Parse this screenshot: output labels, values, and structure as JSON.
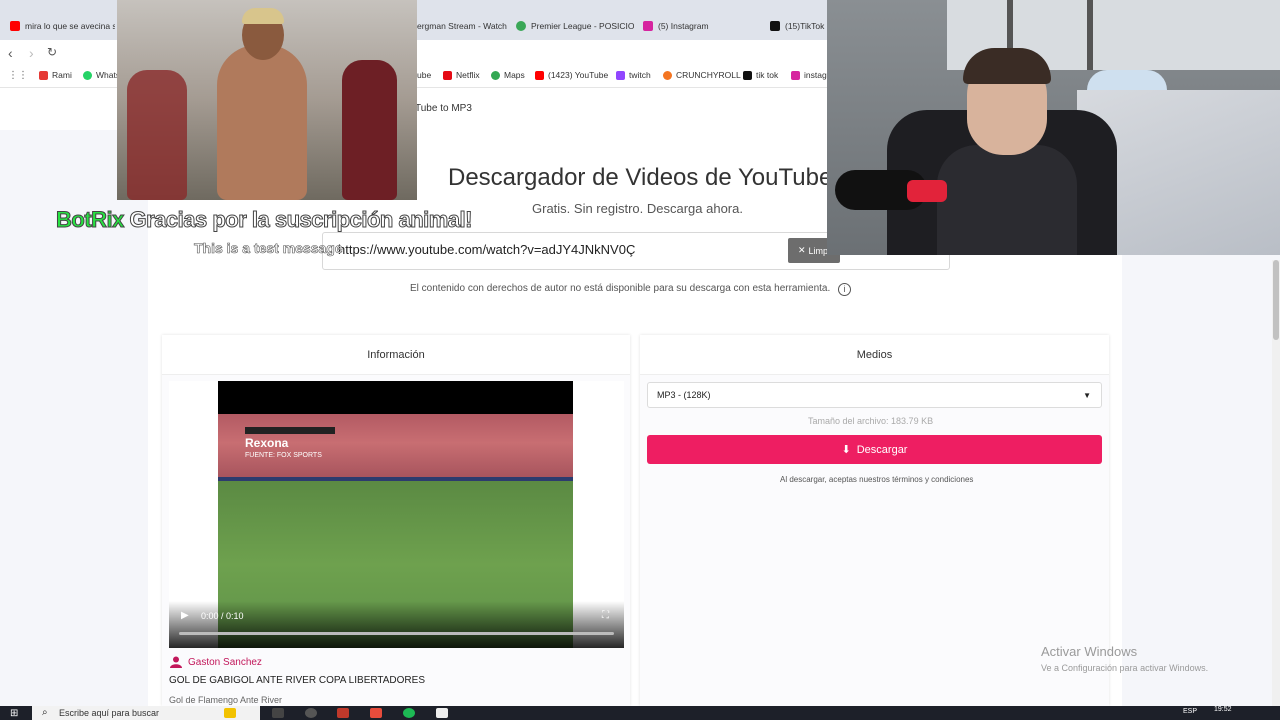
{
  "browser": {
    "tabs": [
      {
        "label": "mira lo que se avecina si e",
        "color": "#ff0000"
      },
      {
        "label": "ergman Stream - Watch",
        "color": "#dddddd"
      },
      {
        "label": "Premier League - POSICIO",
        "color": "#3aa757"
      },
      {
        "label": "(5) Instagram",
        "color": "#d6249f"
      },
      {
        "label": "(15)TikTok -",
        "color": "#111111"
      }
    ],
    "bookmarks": [
      {
        "label": "Rami",
        "color": "#e53935"
      },
      {
        "label": "Whats",
        "color": "#25d366"
      },
      {
        "label": "ube",
        "color": "#ff0000"
      },
      {
        "label": "Netflix",
        "color": "#e50914"
      },
      {
        "label": "Maps",
        "color": "#34a853"
      },
      {
        "label": "(1423) YouTube",
        "color": "#ff0000"
      },
      {
        "label": "twitch",
        "color": "#9146ff"
      },
      {
        "label": "CRUNCHYROLL",
        "color": "#f47521"
      },
      {
        "label": "tik tok",
        "color": "#111111"
      },
      {
        "label": "instag",
        "color": "#d6249f"
      }
    ]
  },
  "site": {
    "breadcrumb": "Tube to MP3",
    "title": "Descargador de Videos de YouTube",
    "subtitle": "Gratis. Sin registro. Descarga ahora.",
    "url_value": "https://www.youtube.com/watch?v=adJY4JNkNV0Ç",
    "clear_label": "Limpi",
    "copyright_note": "El contenido con derechos de autor no está disponible para su descarga con esta herramienta.",
    "info_card": {
      "heading": "Información",
      "author": "Gaston Sanchez",
      "video_title": "GOL DE GABIGOL ANTE RIVER COPA LIBERTADORES",
      "video_desc": "Gol de Flamengo Ante River",
      "player_time": "0:00 / 0:10",
      "overlay_brand": "Rexona",
      "overlay_source": "FUENTE: FOX SPORTS"
    },
    "media_card": {
      "heading": "Medios",
      "format": "MP3 - (128K)",
      "filesize": "Tamaño del archivo: 183.79 KB",
      "download_label": "Descargar",
      "terms": "Al descargar, aceptas nuestros términos y condiciones"
    },
    "accent_color": "#ee1e62"
  },
  "windows_watermark": {
    "title": "Activar Windows",
    "subtitle": "Ve a Configuración para activar Windows."
  },
  "stream_overlay": {
    "bot_name": "BotRix",
    "bot_message": "Gracias por la suscripción animal!",
    "test_message": "This is a test message"
  },
  "taskbar": {
    "search_placeholder": "Escribe aquí para buscar",
    "lang": "ESP",
    "time": "19:52"
  }
}
